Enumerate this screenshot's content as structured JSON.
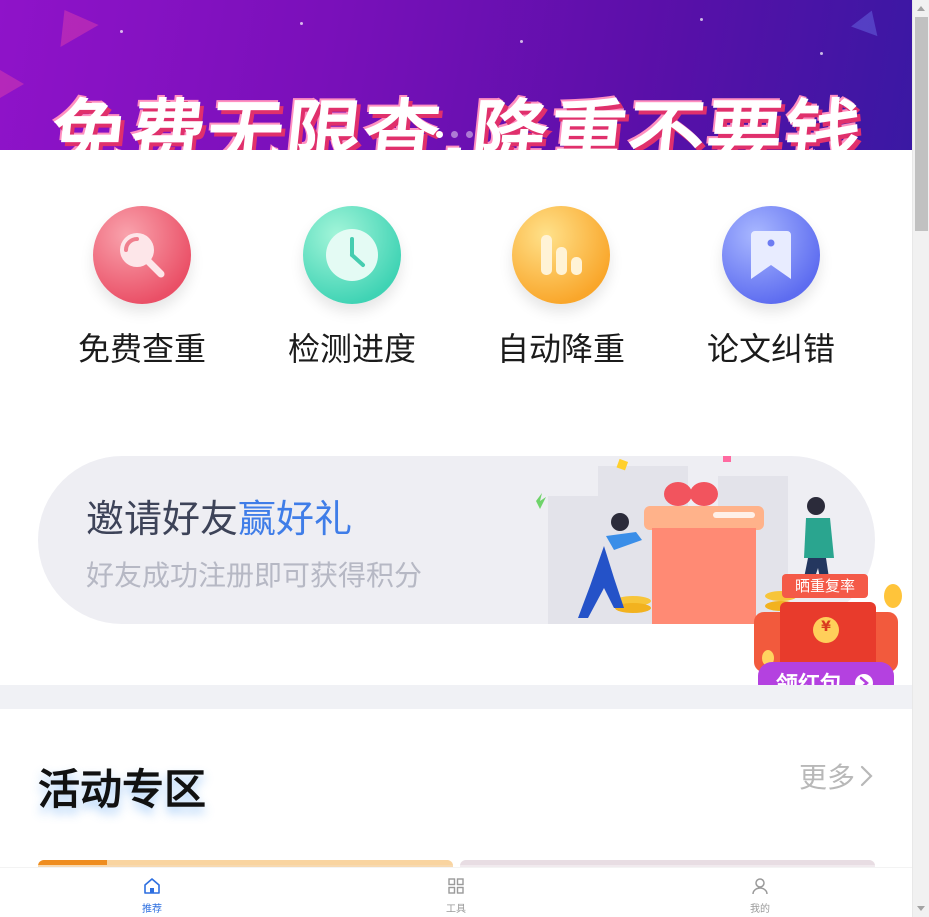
{
  "banner": {
    "headline": "免费无限查,降重不要钱",
    "slide_count": 3,
    "active_slide": 1
  },
  "actions": [
    {
      "label": "免费查重",
      "icon": "magnifier-icon",
      "color_from": "#f58a96",
      "color_to": "#ea4f66"
    },
    {
      "label": "检测进度",
      "icon": "clock-icon",
      "color_from": "#7ff0c8",
      "color_to": "#3fd3b4"
    },
    {
      "label": "自动降重",
      "icon": "bar-chart-icon",
      "color_from": "#ffd35e",
      "color_to": "#f9a62a"
    },
    {
      "label": "论文纠错",
      "icon": "bookmark-icon",
      "color_from": "#8ea2ff",
      "color_to": "#5d6cf0"
    }
  ],
  "invite": {
    "title_prefix": "邀请好友",
    "title_highlight": "赢好礼",
    "subtitle": "好友成功注册即可获得积分"
  },
  "red_packet": {
    "tag": "晒重复率",
    "button": "领红包",
    "currency": "¥"
  },
  "activity": {
    "title": "活动专区",
    "more": "更多"
  },
  "tabbar": {
    "items": [
      {
        "label": "推荐",
        "icon": "home-icon",
        "active": true
      },
      {
        "label": "工具",
        "icon": "grid-icon",
        "active": false
      },
      {
        "label": "我的",
        "icon": "user-icon",
        "active": false
      }
    ]
  },
  "colors": {
    "accent_blue": "#3f7de8",
    "tab_active": "#2d6fe0",
    "banner_purple": "#7a10ba"
  }
}
